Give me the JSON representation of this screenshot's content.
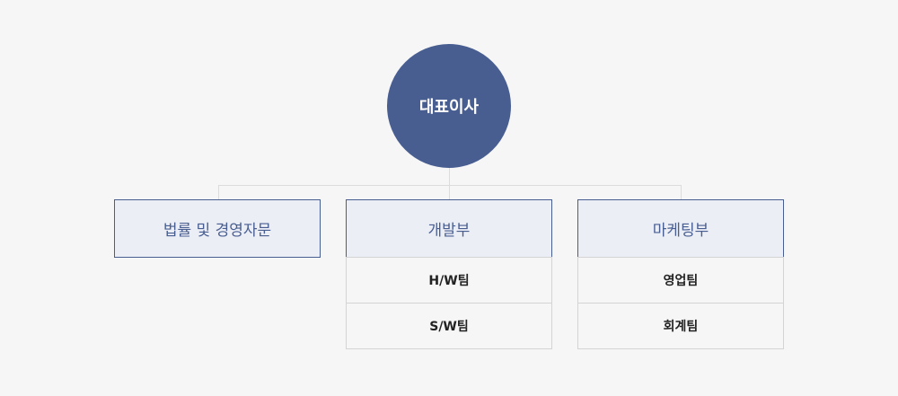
{
  "ceo": {
    "label": "대표이사"
  },
  "departments": [
    {
      "label": "법률 및 경영자문",
      "teams": []
    },
    {
      "label": "개발부",
      "teams": [
        {
          "label": "H/W팀"
        },
        {
          "label": "S/W팀"
        }
      ]
    },
    {
      "label": "마케팅부",
      "teams": [
        {
          "label": "영업팀"
        },
        {
          "label": "회계팀"
        }
      ]
    }
  ],
  "colors": {
    "background": "#f6f6f6",
    "ceo_fill": "#485e91",
    "dept_fill": "#eceef6",
    "dept_border": "#485e91",
    "team_border": "#d4d4d4",
    "connector": "#dcdcdc"
  }
}
